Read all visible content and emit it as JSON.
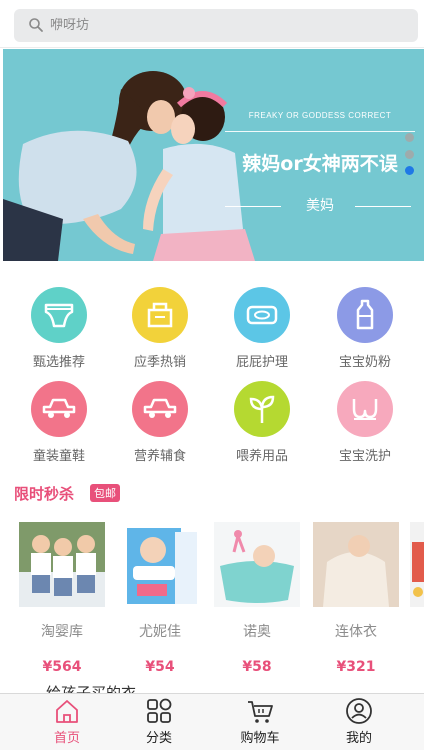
{
  "search": {
    "placeholder": "咿呀坊",
    "icon": "search-icon"
  },
  "banner": {
    "subtitle": "FREAKY OR GODDESS CORRECT",
    "title": "辣妈or女神两不误",
    "tag": "美妈",
    "colors": {
      "background": "#75c8d1",
      "active_dot": "#1f78e6"
    },
    "slides": 3,
    "active_slide": 3
  },
  "categories": [
    {
      "label": "甄选推荐",
      "icon": "diaper-icon",
      "color": "#5fd1c8"
    },
    {
      "label": "应季热销",
      "icon": "box-icon",
      "color": "#f2d23a"
    },
    {
      "label": "屁屁护理",
      "icon": "wipes-icon",
      "color": "#5cc6e6"
    },
    {
      "label": "宝宝奶粉",
      "icon": "milk-bottle-icon",
      "color": "#8c9ae6"
    },
    {
      "label": "童装童鞋",
      "icon": "car-icon",
      "color": "#f2748a"
    },
    {
      "label": "营养辅食",
      "icon": "car-icon",
      "color": "#f2748a"
    },
    {
      "label": "喂养用品",
      "icon": "sprout-icon",
      "color": "#b5d931"
    },
    {
      "label": "宝宝洗护",
      "icon": "bra-icon",
      "color": "#f7a9bd"
    }
  ],
  "flash_sale": {
    "title": "限时秒杀",
    "badge": "包邮",
    "products": [
      {
        "name": "淘婴库",
        "price": "¥564"
      },
      {
        "name": "尤妮佳",
        "price": "¥54"
      },
      {
        "name": "诺奥",
        "price": "¥58"
      },
      {
        "name": "连体衣",
        "price": "¥321"
      }
    ]
  },
  "next_section_partial": "给孩子买的衣",
  "tabbar": {
    "active_color": "#e8507a",
    "items": [
      {
        "label": "首页",
        "icon": "home-icon"
      },
      {
        "label": "分类",
        "icon": "grid-icon"
      },
      {
        "label": "购物车",
        "icon": "cart-icon"
      },
      {
        "label": "我的",
        "icon": "user-icon"
      }
    ]
  }
}
